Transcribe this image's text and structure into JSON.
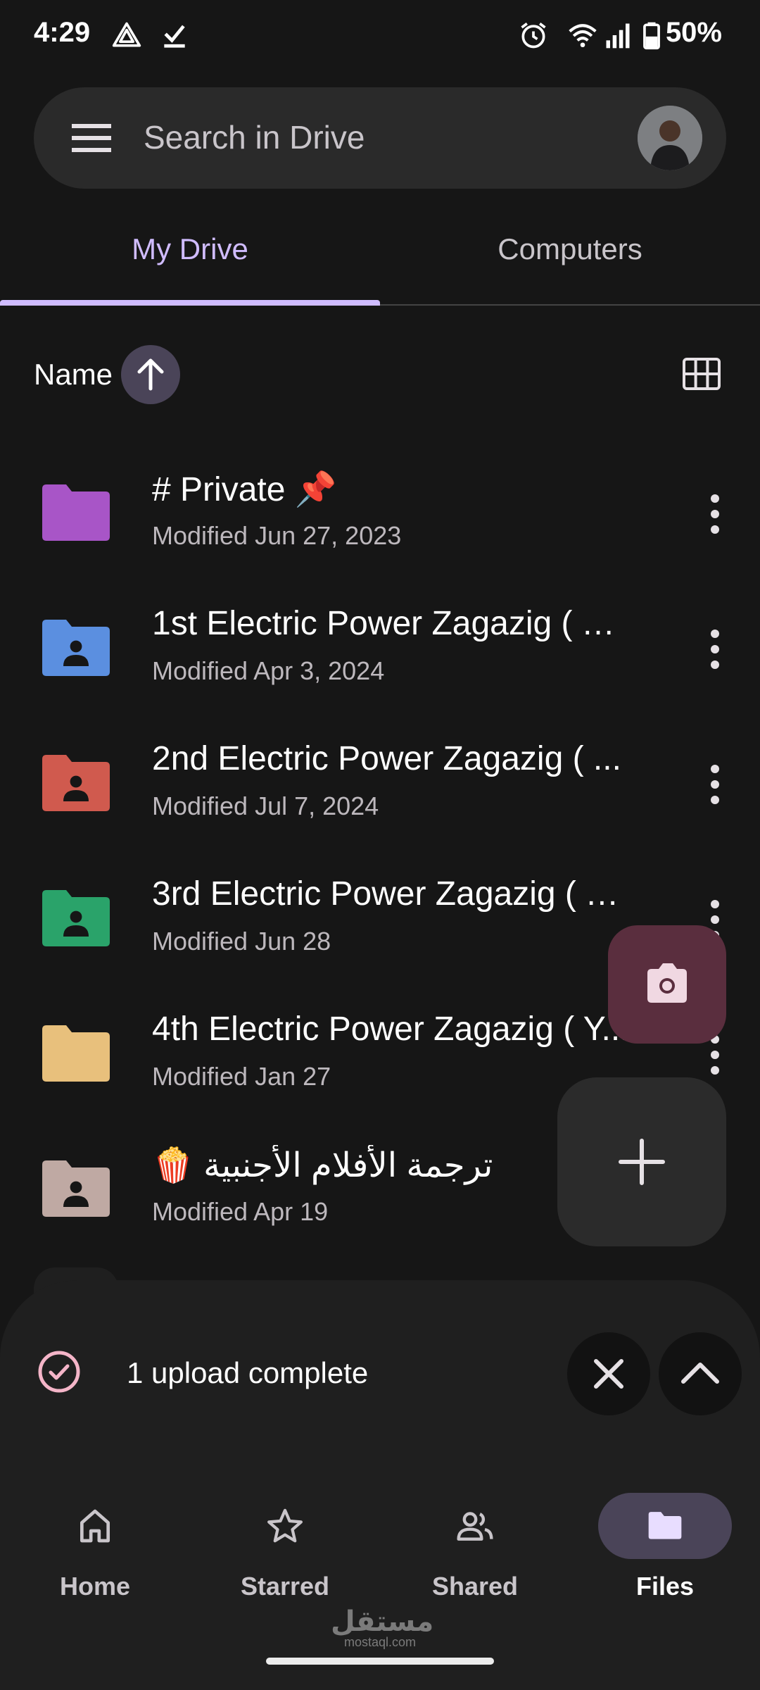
{
  "status_bar": {
    "time": "4:29",
    "battery": "50%",
    "icons": [
      "drive-upload-icon",
      "download-done-icon",
      "alarm-icon",
      "wifi-icon",
      "signal-icon",
      "battery-icon"
    ]
  },
  "search": {
    "placeholder": "Search in Drive",
    "menu_icon": "menu-icon",
    "avatar": "account-avatar"
  },
  "tabs": [
    {
      "label": "My Drive",
      "active": true
    },
    {
      "label": "Computers",
      "active": false
    }
  ],
  "sort": {
    "label": "Name",
    "direction": "ascending",
    "view_toggle": "grid-view-icon"
  },
  "files": [
    {
      "name": "# Private 📌",
      "modified": "Modified Jun 27, 2023",
      "folder_color": "#a855c7",
      "shared": false
    },
    {
      "name": "1st Electric Power Zagazig ( Y....",
      "modified": "Modified Apr 3, 2024",
      "folder_color": "#5b8fe0",
      "shared": true
    },
    {
      "name": "2nd Electric Power Zagazig ( ...",
      "modified": "Modified Jul 7, 2024",
      "folder_color": "#d05a4e",
      "shared": true
    },
    {
      "name": "3rd Electric Power Zagazig ( Y...",
      "modified": "Modified Jun 28",
      "folder_color": "#2aa36a",
      "shared": true
    },
    {
      "name": "4th Electric Power Zagazig ( Y...",
      "modified": "Modified Jan 27",
      "folder_color": "#e8c07c",
      "shared": false
    },
    {
      "name": "ترجمة الأفلام الأجنبية 🍿",
      "modified": "Modified Apr 19",
      "folder_color": "#bfa9a3",
      "shared": true
    }
  ],
  "fabs": {
    "scan": "camera-icon",
    "new": "add-icon"
  },
  "upload": {
    "message": "1 upload complete"
  },
  "bottom_nav": [
    {
      "label": "Home",
      "icon": "home-icon",
      "active": false
    },
    {
      "label": "Starred",
      "icon": "star-icon",
      "active": false
    },
    {
      "label": "Shared",
      "icon": "people-icon",
      "active": false
    },
    {
      "label": "Files",
      "icon": "folder-icon",
      "active": true
    }
  ],
  "watermark": {
    "arabic": "مستقل",
    "latin": "mostaql.com"
  },
  "colors": {
    "accent": "#d0bcff",
    "background": "#161616",
    "surface": "#2a2a2a",
    "fab_camera": "#5a2e3e"
  }
}
